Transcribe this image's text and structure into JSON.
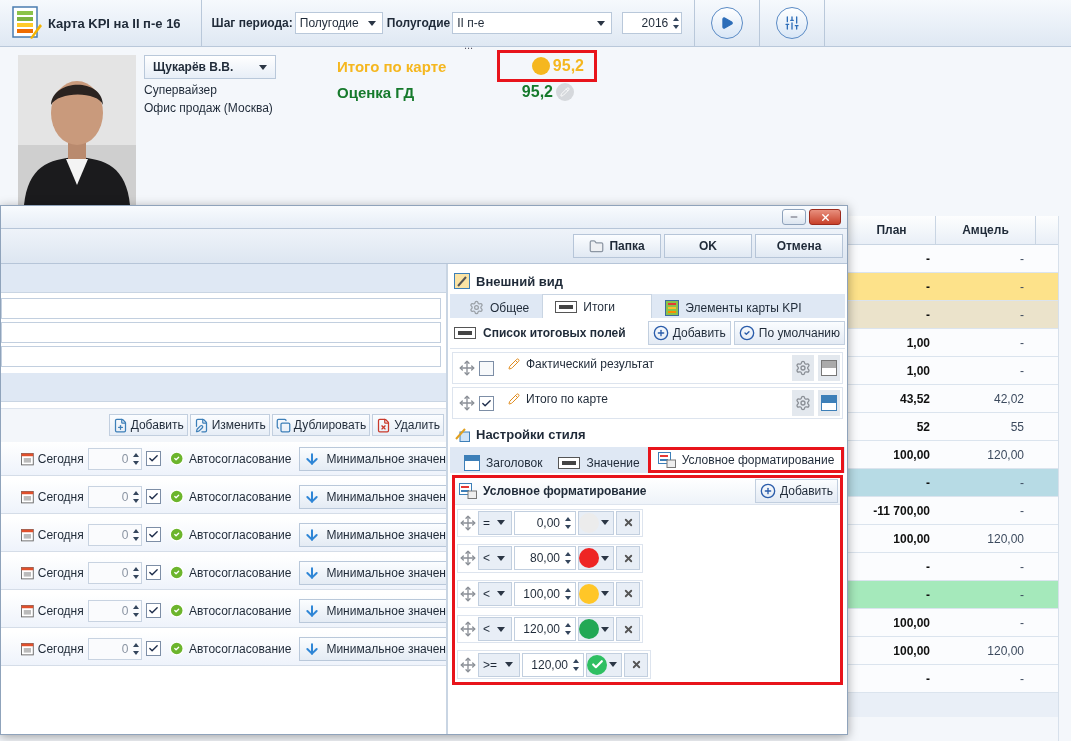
{
  "toolbar": {
    "title": "Карта KPI на II п-е 16",
    "period_step_label": "Шаг периода:",
    "period_step": "Полугодие",
    "half_year_label": "Полугодие",
    "half_year": "II п-е",
    "year": "2016",
    "grip": "..."
  },
  "employee": {
    "name": "Щукарёв В.В.",
    "position": "Супервайзер",
    "office": "Офис продаж (Москва)"
  },
  "scores": [
    {
      "label": "Итого по карте",
      "value": "95,2",
      "color": "#f5b71f",
      "kind": "dot",
      "highlighted": true
    },
    {
      "label": "Оценка ГД",
      "value": "95,2",
      "color": "#167a2c",
      "kind": "edit",
      "highlighted": false
    }
  ],
  "table": {
    "columns": [
      "План",
      "Амцель"
    ],
    "rows": [
      {
        "plan": "-",
        "target": "-"
      },
      {
        "plan": "-",
        "target": "-",
        "color": "#fde28a"
      },
      {
        "plan": "-",
        "target": "-",
        "color": "#ebe3cb"
      },
      {
        "plan": "1,00",
        "target": "-"
      },
      {
        "plan": "1,00",
        "target": "-"
      },
      {
        "plan": "43,52",
        "target": "42,02"
      },
      {
        "plan": "52",
        "target": "55"
      },
      {
        "plan": "100,00",
        "target": "120,00"
      },
      {
        "plan": "-",
        "target": "-",
        "color": "#b7dbe5"
      },
      {
        "plan": "-11 700,00",
        "target": "-"
      },
      {
        "plan": "100,00",
        "target": "120,00"
      },
      {
        "plan": "-",
        "target": "-"
      },
      {
        "plan": "-",
        "target": "-",
        "color": "#a5e9bb"
      },
      {
        "plan": "100,00",
        "target": "-"
      },
      {
        "plan": "100,00",
        "target": "120,00"
      },
      {
        "plan": "-",
        "target": "-"
      }
    ]
  },
  "dialog": {
    "buttons": [
      {
        "label": "Папка",
        "kind": "folder"
      },
      {
        "label": "OK",
        "kind": "plain"
      },
      {
        "label": "Отмена",
        "kind": "plain"
      }
    ],
    "actions": [
      {
        "label": "Добавить",
        "kind": "add"
      },
      {
        "label": "Изменить",
        "kind": "edit"
      },
      {
        "label": "Дублировать",
        "kind": "copy"
      },
      {
        "label": "Удалить",
        "kind": "delete"
      }
    ],
    "rows": [
      {
        "date": "Сегодня",
        "days": "0",
        "checked": true,
        "approval": "Автосогласование",
        "method": "Минимальное значен"
      },
      {
        "date": "Сегодня",
        "days": "0",
        "checked": true,
        "approval": "Автосогласование",
        "method": "Минимальное значен"
      },
      {
        "date": "Сегодня",
        "days": "0",
        "checked": true,
        "approval": "Автосогласование",
        "method": "Минимальное значен"
      },
      {
        "date": "Сегодня",
        "days": "0",
        "checked": true,
        "approval": "Автосогласование",
        "method": "Минимальное значен"
      },
      {
        "date": "Сегодня",
        "days": "0",
        "checked": true,
        "approval": "Автосогласование",
        "method": "Минимальное значен"
      },
      {
        "date": "Сегодня",
        "days": "0",
        "checked": true,
        "approval": "Автосогласование",
        "method": "Минимальное значен"
      }
    ],
    "appearance": {
      "title": "Внешний вид",
      "tabs": [
        {
          "label": "Общее",
          "kind": "gear",
          "selected": false
        },
        {
          "label": "Итоги",
          "kind": "value",
          "selected": true
        },
        {
          "label": "Элементы карты KPI",
          "kind": "card",
          "selected": false
        }
      ],
      "fields_title": "Список итоговых полей",
      "fields_buttons": [
        {
          "label": "Добавить",
          "kind": "add"
        },
        {
          "label": "По умолчанию",
          "kind": "check"
        }
      ],
      "fields": [
        {
          "label": "Фактический результат",
          "checked": false,
          "selected": false
        },
        {
          "label": "Итого по карте",
          "checked": true,
          "selected": true
        }
      ],
      "style_title": "Настройки стиля",
      "style_tabs": [
        {
          "label": "Заголовок",
          "kind": "header",
          "selected": false,
          "highlighted": false
        },
        {
          "label": "Значение",
          "kind": "value",
          "selected": false,
          "highlighted": false
        },
        {
          "label": "Условное форматирование",
          "kind": "format",
          "selected": true,
          "highlighted": true
        }
      ],
      "format": {
        "title": "Условное форматирование",
        "add": "Добавить",
        "highlighted": true,
        "rules": [
          {
            "operator": "=",
            "value": "0,00",
            "color": "#ececec",
            "kind": "dot"
          },
          {
            "operator": "<",
            "value": "80,00",
            "color": "#ee2424",
            "kind": "dot"
          },
          {
            "operator": "<",
            "value": "100,00",
            "color": "#ffc628",
            "kind": "dot"
          },
          {
            "operator": "<",
            "value": "120,00",
            "color": "#22a855",
            "kind": "dot"
          },
          {
            "operator": ">=",
            "value": "120,00",
            "color": "#2fbf62",
            "kind": "check"
          }
        ]
      }
    }
  }
}
